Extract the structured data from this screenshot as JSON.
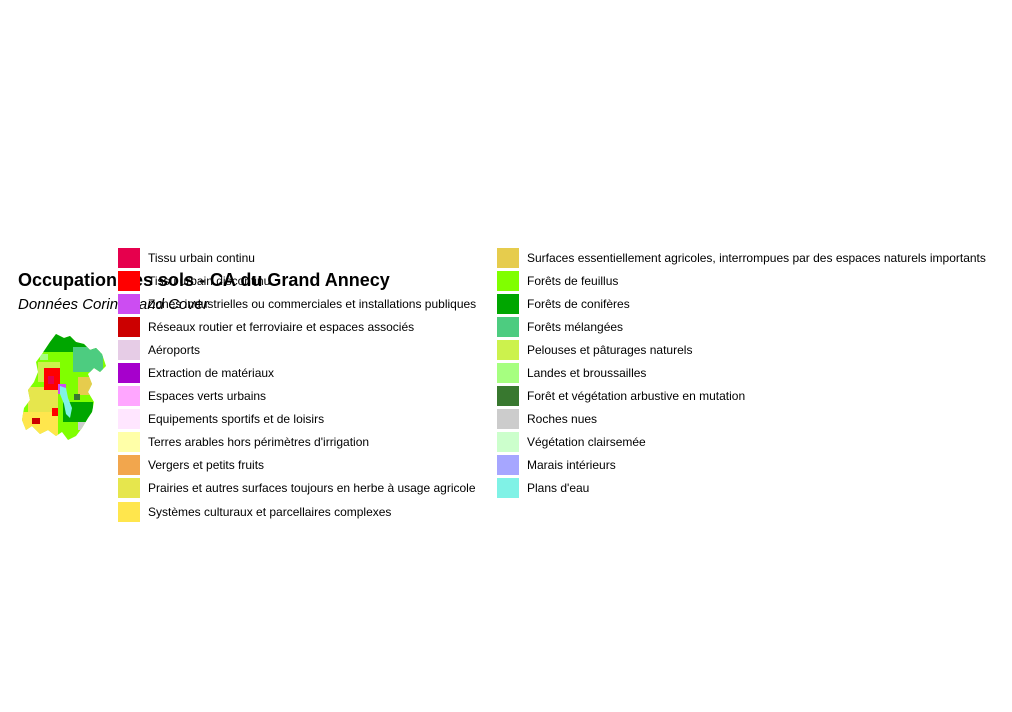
{
  "title": "Occupation des sols - CA du Grand Annecy",
  "subtitle": "Données Corine Land Cover",
  "legend": {
    "left": [
      {
        "label": "Tissu urbain continu",
        "color": "#e6004d"
      },
      {
        "label": "Tissu urbain discontinu",
        "color": "#ff0000"
      },
      {
        "label": "Zones industrielles ou commerciales et installations publiques",
        "color": "#cc4df2"
      },
      {
        "label": "Réseaux routier et ferroviaire et espaces associés",
        "color": "#cc0000"
      },
      {
        "label": "Aéroports",
        "color": "#e6cce6"
      },
      {
        "label": "Extraction de matériaux",
        "color": "#a600cc"
      },
      {
        "label": "Espaces verts urbains",
        "color": "#ffa6ff"
      },
      {
        "label": "Equipements sportifs et de loisirs",
        "color": "#ffe6ff"
      },
      {
        "label": "Terres arables hors périmètres d'irrigation",
        "color": "#ffffa8"
      },
      {
        "label": "Vergers et petits fruits",
        "color": "#f2a64d"
      },
      {
        "label": "Prairies et autres surfaces toujours en herbe à usage agricole",
        "color": "#e6e64d"
      },
      {
        "label": "Systèmes culturaux et parcellaires complexes",
        "color": "#ffe64d"
      }
    ],
    "right": [
      {
        "label": "Surfaces essentiellement agricoles, interrompues par des espaces naturels importants",
        "color": "#e6cc4d"
      },
      {
        "label": "Forêts de feuillus",
        "color": "#80ff00"
      },
      {
        "label": "Forêts de conifères",
        "color": "#00a600"
      },
      {
        "label": "Forêts mélangées",
        "color": "#4dcc80"
      },
      {
        "label": "Pelouses et pâturages naturels",
        "color": "#ccf24d"
      },
      {
        "label": "Landes et broussailles",
        "color": "#a6ff80"
      },
      {
        "label": "Forêt et végétation arbustive en mutation",
        "color": "#38782f"
      },
      {
        "label": "Roches nues",
        "color": "#cccccc"
      },
      {
        "label": "Végétation clairsemée",
        "color": "#ccffcc"
      },
      {
        "label": "Marais intérieurs",
        "color": "#a6a6ff"
      },
      {
        "label": "Plans d'eau",
        "color": "#80f2e6"
      }
    ]
  }
}
